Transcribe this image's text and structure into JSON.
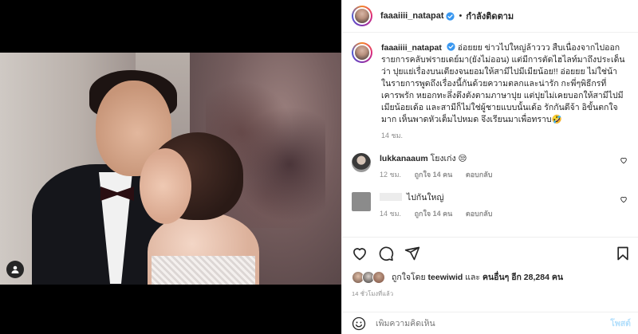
{
  "header": {
    "username": "faaaiiii_natapat",
    "separator": "•",
    "follow_status": "กำลังติดตาม"
  },
  "caption": {
    "username": "faaaiiii_natapat",
    "text": "อ่อยยย ข่าวไปใหญ่ล้าววว สืบเนื่องจากไปออกรายการคลับฟรายเดย์มา(ยังไม่ออน) แต่มีการตัดไฮไลท์มาถึงประเด็นว่า ปุยแย่เรื่องบนเตียงจนยอมให้สามีไปมีเมียน้อย!! อ่อยยย ไม่ใช่น้า ในรายการพูดถึงเรื่องนี้กันด้วยความตลกและน่ารัก กะพี่ๆพิธีกรที่เคารพรัก หยอกทะลึ่งตึงตังตามภาษาปุย แต่ปุยไม่เคยบอกให้สามีไปมีเมียน้อยเด้อ และสามีก็ไม่ใช่ผู้ชายแบบนั้นเด้อ รักกันดีจ้า อิขั้นตกใจมาก เห็นพาดหัวเต็มไปหมด จึงเรียนมาเพื่อทราบ🤣",
    "time": "14 ชม."
  },
  "comments": [
    {
      "username": "lukkanaaum",
      "text": "โยงเก่ง 😒",
      "time": "12 ชม.",
      "likes": "ถูกใจ 14 คน",
      "reply": "ตอบกลับ"
    },
    {
      "username": "",
      "text": "ไปกันใหญ่",
      "time": "14 ชม.",
      "likes": "ถูกใจ 14 คน",
      "reply": "ตอบกลับ"
    }
  ],
  "likes": {
    "prefix": "ถูกใจโดย",
    "user": "teewiwid",
    "and": "และ",
    "others": "คนอื่นๆ อีก 28,284 คน"
  },
  "timestamp": "14 ชั่วโมงที่แล้ว",
  "add_comment": {
    "placeholder": "เพิ่มความคิดเห็น",
    "post_label": "โพสต์"
  },
  "colors": {
    "verified": "#3897f0",
    "link_disabled": "#b2dffc",
    "muted": "#8e8e8e"
  }
}
